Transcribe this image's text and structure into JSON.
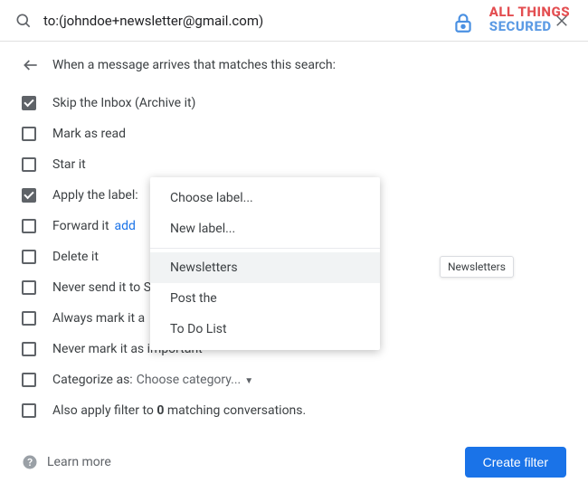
{
  "search": {
    "query": "to:(johndoe+newsletter@gmail.com)"
  },
  "watermark": {
    "line1": "ALL THINGS",
    "line2": "SECURED"
  },
  "header": {
    "text": "When a message arrives that matches this search:"
  },
  "options": {
    "skip_inbox": "Skip the Inbox (Archive it)",
    "mark_read": "Mark as read",
    "star_it": "Star it",
    "apply_label": "Apply the label:",
    "forward_it": "Forward it",
    "forward_add": "add",
    "delete_it": "Delete it",
    "never_spam": "Never send it to S",
    "always_important": "Always mark it a",
    "never_important": "Never mark it as important",
    "categorize_as": "Categorize as:",
    "categorize_select": "Choose category...",
    "also_apply_pre": "Also apply filter to ",
    "also_apply_count": "0",
    "also_apply_post": " matching conversations."
  },
  "dropdown": {
    "choose_label": "Choose label...",
    "new_label": "New label...",
    "newsletters": "Newsletters",
    "post_the": "Post the",
    "todo": "To Do List",
    "tooltip": "Newsletters"
  },
  "footer": {
    "learn_more": "Learn more",
    "create": "Create filter"
  }
}
